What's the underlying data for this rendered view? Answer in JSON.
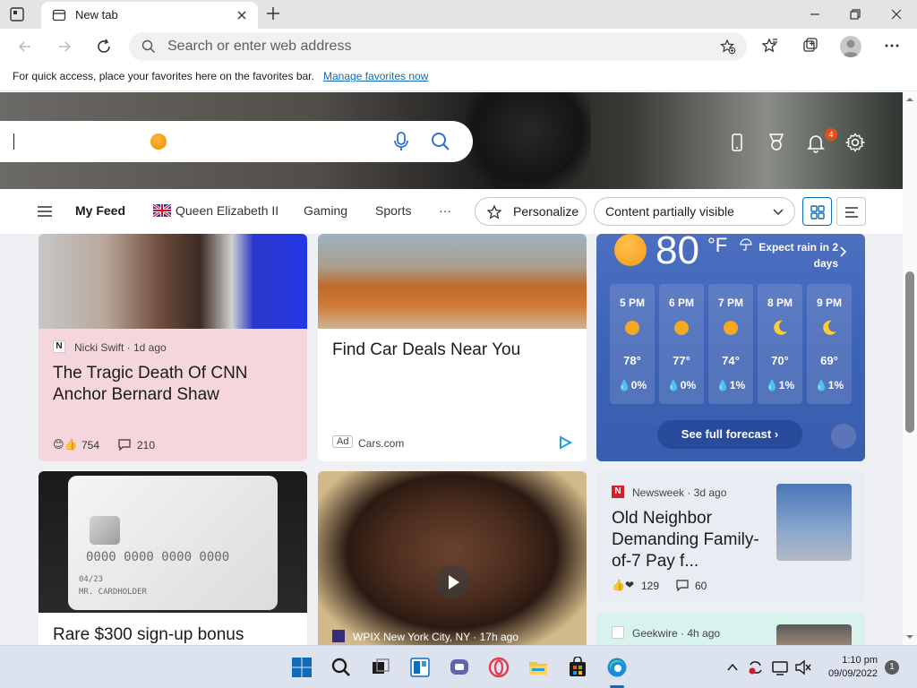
{
  "browser": {
    "tab_title": "New tab",
    "address_placeholder": "Search or enter web address",
    "favorites_bar_message": "For quick access, place your favorites here on the favorites bar.",
    "favorites_bar_link": "Manage favorites now"
  },
  "newtab": {
    "notification_count": "4",
    "feed_nav": {
      "my_feed": "My Feed",
      "queen": "Queen Elizabeth II",
      "gaming": "Gaming",
      "sports": "Sports",
      "more": "···",
      "personalize": "Personalize",
      "content_mode": "Content partially visible"
    }
  },
  "cards": {
    "shaw": {
      "source": "Nicki Swift · 1d ago",
      "headline": "The Tragic Death Of CNN Anchor Bernard Shaw",
      "reactions": "754",
      "comments": "210"
    },
    "cars": {
      "headline": "Find Car Deals Near You",
      "ad_label": "Ad",
      "source": "Cars.com"
    },
    "card_bonus": {
      "headline": "Rare $300 sign-up bonus",
      "card_number": "0000  0000  0000  0000",
      "card_date": "04/23",
      "card_holder": "MR. CARDHOLDER"
    },
    "wpix": {
      "source": "WPIX New York City, NY · 17h ago"
    },
    "neighbor": {
      "source": "Newsweek · 3d ago",
      "headline": "Old Neighbor Demanding Family-of-7 Pay f...",
      "reactions": "129",
      "comments": "60"
    },
    "geekwire": {
      "source": "Geekwire · 4h ago"
    }
  },
  "weather": {
    "temp": "80",
    "unit": "°F",
    "rain_note": "Expect rain in 2 days",
    "hours": [
      {
        "time": "5 PM",
        "temp": "78°",
        "precip": "0%",
        "icon": "sun"
      },
      {
        "time": "6 PM",
        "temp": "77°",
        "precip": "0%",
        "icon": "sun"
      },
      {
        "time": "7 PM",
        "temp": "74°",
        "precip": "1%",
        "icon": "sun"
      },
      {
        "time": "8 PM",
        "temp": "70°",
        "precip": "1%",
        "icon": "moon"
      },
      {
        "time": "9 PM",
        "temp": "69°",
        "precip": "1%",
        "icon": "moon"
      }
    ],
    "forecast_button": "See full forecast"
  },
  "taskbar": {
    "time": "1:10 pm",
    "date": "09/09/2022",
    "notification_count": "1"
  },
  "colors": {
    "accent": "#0f6cbd",
    "weather_bg": "#3c62b5",
    "card_pink": "#f6d6dd"
  }
}
